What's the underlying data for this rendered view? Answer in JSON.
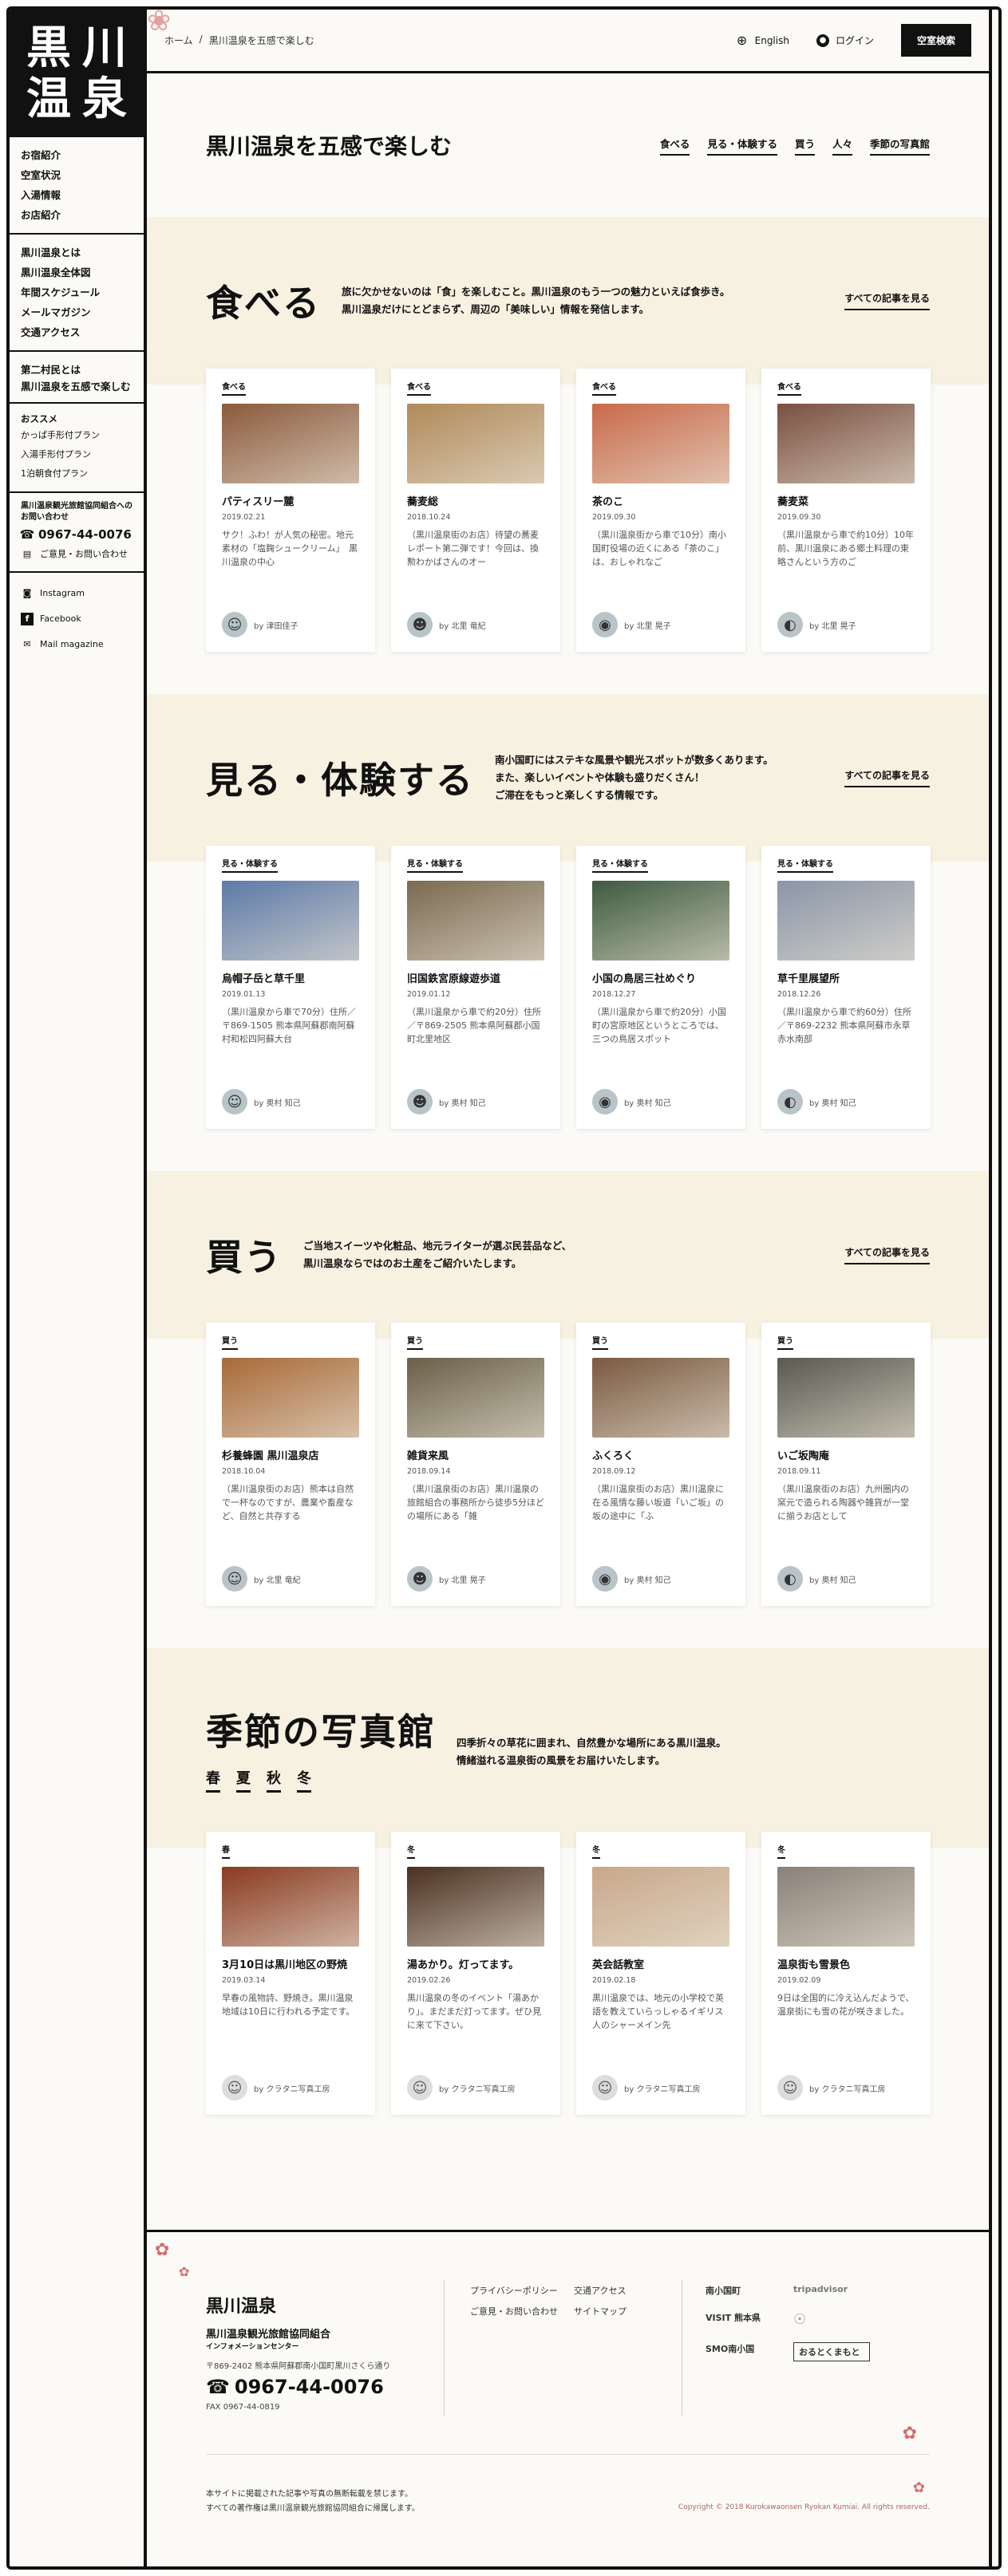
{
  "sidebar": {
    "logo": [
      "黒",
      "川",
      "温",
      "泉"
    ],
    "group1": [
      "お宿紹介",
      "空室状況",
      "入湯情報",
      "お店紹介"
    ],
    "group2": [
      "黒川温泉とは",
      "黒川温泉全体図",
      "年間スケジュール",
      "メールマガジン",
      "交通アクセス"
    ],
    "group3": [
      "第二村民とは",
      "黒川温泉を五感で楽しむ"
    ],
    "recommend_title": "おススメ",
    "recommend": [
      "かっぱ手形付プラン",
      "入湯手形付プラン",
      "1泊朝食付プラン"
    ],
    "org_title": "黒川温泉観光旅館協同組合へのお問い合わせ",
    "phone": "0967-44-0076",
    "contact": "ご意見・お問い合わせ",
    "social": [
      "Instagram",
      "Facebook",
      "Mail magazine"
    ]
  },
  "topbar": {
    "crumb_home": "ホーム",
    "crumb_sep": "/",
    "crumb_current": "黒川温泉を五感で楽しむ",
    "english": "English",
    "login": "ログイン",
    "vacancy_button": "空室検索"
  },
  "page": {
    "title": "黒川温泉を五感で楽しむ",
    "nav": [
      "食べる",
      "見る・体験する",
      "買う",
      "人々",
      "季節の写真館"
    ]
  },
  "more_label": "すべての記事を見る",
  "sections": {
    "taberu": {
      "title": "食べる",
      "desc": [
        "旅に欠かせないのは「食」を楽しむこと。黒川温泉のもう一つの魅力といえば食歩き。",
        "黒川温泉だけにとどまらず、周辺の「美味しい」情報を発信します。"
      ],
      "cards": [
        {
          "cat": "食べる",
          "title": "パティスリー麓",
          "date": "2019.02.21",
          "excerpt": "サク！ふわ！が人気の秘密。地元素材の「塩麹シュークリーム」　黒川温泉の中心",
          "author": "by 津田佳子",
          "thumb": "#8b5a3c"
        },
        {
          "cat": "食べる",
          "title": "蕎麦総",
          "date": "2018.10.24",
          "excerpt": "（黒川温泉街のお店）待望の蕎麦レポート第二弾です！今回は、換勲わかばさんのオー",
          "author": "by 北里 竜紀",
          "thumb": "#b08a5a"
        },
        {
          "cat": "食べる",
          "title": "茶のこ",
          "date": "2019.09.30",
          "excerpt": "（黒川温泉街から車で10分）南小国町役場の近くにある「茶のこ」は、おしゃれなご",
          "author": "by 北里 晃子",
          "thumb": "#c96a4a"
        },
        {
          "cat": "食べる",
          "title": "蕎麦菜",
          "date": "2019.09.30",
          "excerpt": "（黒川温泉から車で約10分）10年前、黒川温泉にある郷土料理の東略さんという方のご",
          "author": "by 北里 晃子",
          "thumb": "#7a5040"
        }
      ]
    },
    "miru": {
      "title": "見る・体験する",
      "desc": [
        "南小国町にはステキな風景や観光スポットが数多くあります。",
        "また、楽しいイベントや体験も盛りだくさん！",
        "ご滞在をもっと楽しくする情報です。"
      ],
      "cards": [
        {
          "cat": "見る・体験する",
          "title": "烏帽子岳と草千里",
          "date": "2019.01.13",
          "excerpt": "（黒川温泉から車で70分）住所／〒869-1505 熊本県阿蘇郡南阿蘇村和松四阿蘇大台",
          "author": "by 奥村 知己",
          "thumb": "#5d7aa8"
        },
        {
          "cat": "見る・体験する",
          "title": "旧国鉄宮原線遊歩道",
          "date": "2019.01.12",
          "excerpt": "（黒川温泉から車で約20分）住所／〒869-2505 熊本県阿蘇郡小国町北里地区",
          "author": "by 奥村 知己",
          "thumb": "#7a6a50"
        },
        {
          "cat": "見る・体験する",
          "title": "小国の鳥居三社めぐり",
          "date": "2018.12.27",
          "excerpt": "（黒川温泉から車で約20分）小国町の宮原地区というところでは、三つの鳥居スポット",
          "author": "by 奥村 知己",
          "thumb": "#3e5a40"
        },
        {
          "cat": "見る・体験する",
          "title": "草千里展望所",
          "date": "2018.12.26",
          "excerpt": "（黒川温泉から車で約60分）住所／〒869-2232 熊本県阿蘇市永草 赤水南部",
          "author": "by 奥村 知己",
          "thumb": "#8a96a8"
        }
      ]
    },
    "kau": {
      "title": "買う",
      "desc": [
        "ご当地スイーツや化粧品、地元ライターが選ぶ民芸品など、",
        "黒川温泉ならではのお土産をご紹介いたします。"
      ],
      "cards": [
        {
          "cat": "買う",
          "title": "杉養蜂園 黒川温泉店",
          "date": "2018.10.04",
          "excerpt": "（黒川温泉街のお店）熊本は自然で一杯なのですが、農業や畜産など、自然と共存する",
          "author": "by 北里 竜紀",
          "thumb": "#a86a38"
        },
        {
          "cat": "買う",
          "title": "雑貨来風",
          "date": "2018.09.14",
          "excerpt": "（黒川温泉街のお店）黒川温泉の旅館組合の事務所から徒歩5分ほどの場所にある「雑",
          "author": "by 北里 晃子",
          "thumb": "#6a6048"
        },
        {
          "cat": "買う",
          "title": "ふくろく",
          "date": "2018.09.12",
          "excerpt": "（黒川温泉街のお店）黒川温泉に在る風情な藤い坂道「いご坂」の坂の途中に「ふ",
          "author": "by 奥村 知己",
          "thumb": "#7a5a40"
        },
        {
          "cat": "買う",
          "title": "いご坂陶庵",
          "date": "2018.09.11",
          "excerpt": "（黒川温泉街のお店）九州圏内の窯元で造られる陶器や雑貨が一堂に揃うお店として",
          "author": "by 奥村 知己",
          "thumb": "#5a5a50"
        }
      ]
    },
    "kisetsu": {
      "title": "季節の写真館",
      "desc": [
        "四季折々の草花に囲まれ、自然豊かな場所にある黒川温泉。",
        "情緒溢れる温泉街の風景をお届けいたします。"
      ],
      "seasons": [
        "春",
        "夏",
        "秋",
        "冬"
      ],
      "cards": [
        {
          "cat": "春",
          "title": "3月10日は黒川地区の野焼",
          "date": "2019.03.14",
          "excerpt": "早春の風物詩、野焼き。黒川温泉地域は10日に行われる予定です。",
          "author": "by クラタニ写真工房",
          "thumb": "#8a3a20"
        },
        {
          "cat": "冬",
          "title": "湯あかり。灯ってます。",
          "date": "2019.02.26",
          "excerpt": "黒川温泉の冬のイベント「湯あかり」。まだまだ灯ってます。ぜひ見に来て下さい。",
          "author": "by クラタニ写真工房",
          "thumb": "#4a3020"
        },
        {
          "cat": "冬",
          "title": "英会話教室",
          "date": "2019.02.18",
          "excerpt": "黒川温泉では、地元の小学校で英語を教えていらっしゃるイギリス人のシャーメイン先",
          "author": "by クラタニ写真工房",
          "thumb": "#c8a88a"
        },
        {
          "cat": "冬",
          "title": "温泉街も雪景色",
          "date": "2019.02.09",
          "excerpt": "9日は全国的に冷え込んだようで、温泉街にも雪の花が咲きました。",
          "author": "by クラタニ写真工房",
          "thumb": "#8a8078"
        }
      ]
    }
  },
  "footer": {
    "logo": "黒川温泉",
    "org": "黒川温泉観光旅館協同組合",
    "org_sub": "インフォメーションセンター",
    "address": "〒869-2402 熊本県阿蘇郡南小国町黒川さくら通り",
    "tel": "0967-44-0076",
    "fax": "FAX  0967-44-0819",
    "links": [
      "プライバシーポリシー",
      "交通アクセス",
      "ご意見・お問い合わせ",
      "サイトマップ"
    ],
    "logos": [
      "南小国町",
      "tripadvisor",
      "VISIT 熊本県",
      "",
      "SMO南小国",
      "おるとくまもと"
    ],
    "note": [
      "本サイトに掲載された記事や写真の無断転載を禁じます。",
      "すべての著作権は黒川温泉観光旅館協同組合に帰属します。"
    ],
    "copyright": "Copyright © 2018 Kurokawaonsen Ryokan Kumiai. All rights reserved."
  }
}
